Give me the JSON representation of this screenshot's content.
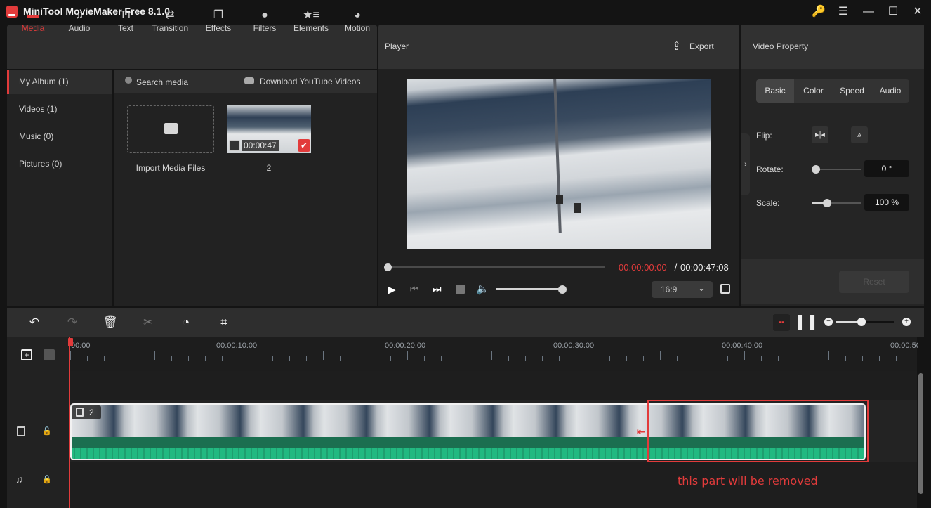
{
  "app": {
    "title": "MiniTool MovieMaker Free 8.1.0"
  },
  "window_controls": {
    "key": "key-icon",
    "menu": "menu-icon",
    "minimize": "minimize-icon",
    "maximize": "maximize-icon",
    "close": "close-icon"
  },
  "media_tabs": [
    {
      "label": "Media",
      "icon": "folder-icon",
      "active": true
    },
    {
      "label": "Audio",
      "icon": "music-note-icon"
    },
    {
      "label": "Text",
      "icon": "text-icon"
    },
    {
      "label": "Transition",
      "icon": "transition-icon"
    },
    {
      "label": "Effects",
      "icon": "effects-icon"
    },
    {
      "label": "Filters",
      "icon": "filters-icon"
    },
    {
      "label": "Elements",
      "icon": "elements-icon"
    },
    {
      "label": "Motion",
      "icon": "motion-icon"
    }
  ],
  "sidebar": {
    "items": [
      {
        "label": "My Album (1)",
        "active": true
      },
      {
        "label": "Videos (1)"
      },
      {
        "label": "Music (0)"
      },
      {
        "label": "Pictures (0)"
      }
    ]
  },
  "media": {
    "search_placeholder": "Search media",
    "download_label": "Download YouTube Videos",
    "import_label": "Import Media Files",
    "clip": {
      "duration": "00:00:47",
      "name": "2",
      "selected": true
    }
  },
  "player": {
    "title": "Player",
    "export_label": "Export",
    "current_time": "00:00:00:00",
    "separator": " / ",
    "total_time": "00:00:47:08",
    "progress": 0,
    "volume": 1.0,
    "aspect_ratio": "16:9"
  },
  "property": {
    "title": "Video Property",
    "tabs": [
      "Basic",
      "Color",
      "Speed",
      "Audio"
    ],
    "active_tab": "Basic",
    "flip_label": "Flip:",
    "rotate_label": "Rotate:",
    "rotate_value": "0 °",
    "scale_label": "Scale:",
    "scale_value": "100 %",
    "reset_label": "Reset"
  },
  "timeline": {
    "ruler_labels": [
      "00:00",
      "00:00:10:00",
      "00:00:20:00",
      "00:00:30:00",
      "00:00:40:00",
      "00:00:50"
    ],
    "clip_label": "2",
    "zoom_level": 0.55,
    "annotation": "this part will be removed",
    "accent": "#e23b3b",
    "audio_color": "#22b981"
  }
}
